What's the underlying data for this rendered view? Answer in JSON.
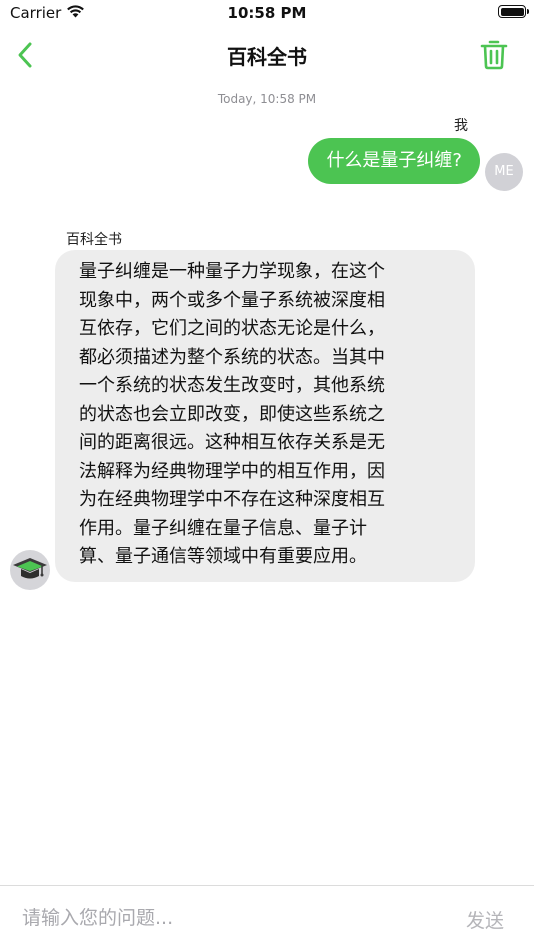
{
  "status_bar": {
    "carrier": "Carrier",
    "time": "10:58 PM",
    "battery_level": 1.0
  },
  "nav": {
    "title": "百科全书",
    "back_icon": "chevron-left-icon",
    "action_icon": "trash-icon",
    "accent_color": "#4cc452"
  },
  "chat": {
    "timestamp": "Today, 10:58 PM",
    "messages": [
      {
        "sender": "我",
        "avatar_text": "ME",
        "text": "什么是量子纠缠?",
        "bubble_color": "#4cc452"
      },
      {
        "sender": "百科全书",
        "avatar_icon": "graduation-cap-icon",
        "lines": [
          "量子纠缠是一种量子力学现象，在这个",
          "现象中，两个或多个量子系统被深度相",
          "互依存，它们之间的状态无论是什么，",
          "都必须描述为整个系统的状态。当其中",
          "一个系统的状态发生改变时，其他系统",
          "的状态也会立即改变，即使这些系统之",
          "间的距离很远。这种相互依存关系是无",
          "法解释为经典物理学中的相互作用，因",
          "为在经典物理学中不存在这种深度相互",
          "作用。量子纠缠在量子信息、量子计",
          "算、量子通信等领域中有重要应用。"
        ],
        "bubble_color": "#ededed"
      }
    ]
  },
  "input": {
    "placeholder": "请输入您的问题...",
    "value": "",
    "send_label": "发送"
  }
}
